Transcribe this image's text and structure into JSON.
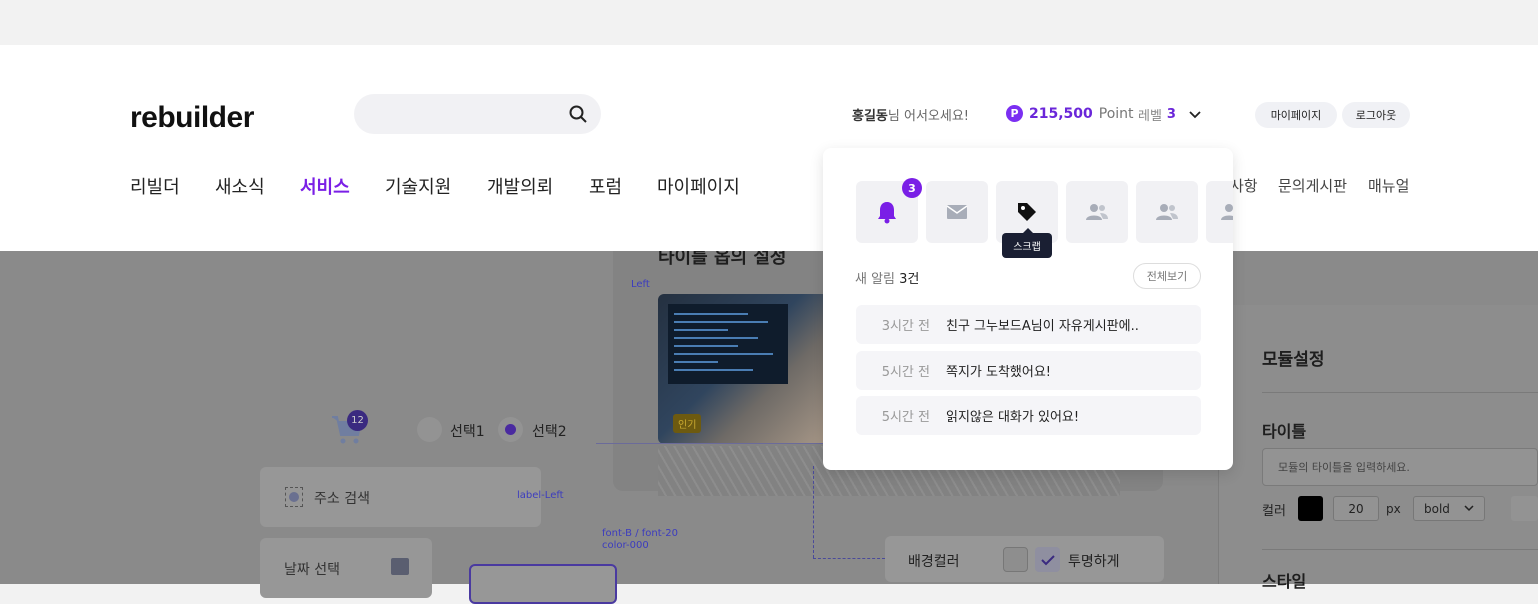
{
  "header": {
    "logo": "rebuilder",
    "greeting_name": "홍길동",
    "greeting_suffix": "님 어서오세요!",
    "point_symbol": "P",
    "point_value": "215,500",
    "point_unit": "Point",
    "level_label": "레벨",
    "level_value": "3",
    "mypage_label": "마이페이지",
    "logout_label": "로그아웃"
  },
  "nav": {
    "items": [
      "리빌더",
      "새소식",
      "서비스",
      "기술지원",
      "개발의뢰",
      "포럼",
      "마이페이지"
    ],
    "active_index": 2,
    "right_items": [
      "사항",
      "문의게시판",
      "매뉴얼"
    ]
  },
  "notification": {
    "badge_count": "3",
    "tooltip": "스크랩",
    "new_label": "새 알림",
    "new_count": "3건",
    "view_all": "전체보기",
    "items": [
      {
        "time": "3시간 전",
        "message": "친구 그누보드A님이 자유게시판에.."
      },
      {
        "time": "5시간 전",
        "message": "쪽지가 도착했어요!"
      },
      {
        "time": "5시간 전",
        "message": "읽지않은 대화가 있어요!"
      }
    ]
  },
  "background": {
    "card_title": "타이틀 옵의 설정",
    "left_label": "Left",
    "popular_badge": "인기",
    "cart_count": "12",
    "radio1": "선택1",
    "radio2": "선택2",
    "address_search": "주소 검색",
    "label_left": "label-Left",
    "date_select": "날짜 선택",
    "font_spec_1": "font-B / font-20",
    "font_spec_2": "color-000",
    "bg_color_label": "배경컬러",
    "transparent_label": "투명하게",
    "module_settings": "모듈설정",
    "title_label": "타이틀",
    "title_placeholder": "모듈의 타이틀을 입력하세요.",
    "color_label": "컬러",
    "font_size": "20",
    "px_label": "px",
    "weight_value": "bold",
    "style_label": "스타일"
  },
  "colors": {
    "accent": "#7a1fe6",
    "overlay": "#8a8a8a",
    "tooltip_bg": "#1a1f33"
  }
}
